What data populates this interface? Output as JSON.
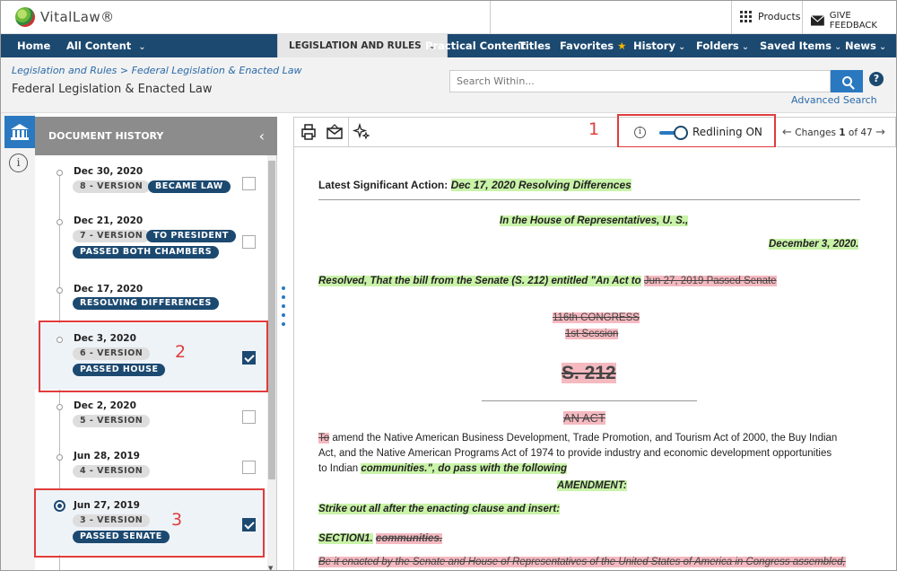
{
  "brand": {
    "name": "VitalLaw",
    "reg": "®"
  },
  "topbar": {
    "products": "Products",
    "feedback": "GIVE FEEDBACK"
  },
  "nav": {
    "home": "Home",
    "all_content": "All Content",
    "legislation": "LEGISLATION AND RULES",
    "practical": "Practical Content",
    "titles": "Titles",
    "favorites": "Favorites",
    "history": "History",
    "folders": "Folders",
    "saved": "Saved Items",
    "news": "News"
  },
  "header": {
    "breadcrumb": "Legislation and Rules > Federal Legislation & Enacted Law",
    "title": "Federal Legislation & Enacted Law",
    "search_placeholder": "Search Within...",
    "advanced": "Advanced Search"
  },
  "history_panel": {
    "title": "DOCUMENT HISTORY",
    "entries": [
      {
        "date": "Dec 30, 2020",
        "version": "8 - VERSION",
        "status": [
          "BECAME LAW"
        ],
        "checked": false
      },
      {
        "date": "Dec 21, 2020",
        "version": "7 - VERSION",
        "status": [
          "TO PRESIDENT",
          "PASSED BOTH CHAMBERS"
        ],
        "checked": false
      },
      {
        "date": "Dec 17, 2020",
        "version": "",
        "status": [
          "RESOLVING DIFFERENCES"
        ],
        "checked": false
      },
      {
        "date": "Dec 3, 2020",
        "version": "6 - VERSION",
        "status": [
          "PASSED HOUSE"
        ],
        "checked": true
      },
      {
        "date": "Dec 2, 2020",
        "version": "5 - VERSION",
        "status": [],
        "checked": false
      },
      {
        "date": "Jun 28, 2019",
        "version": "4 - VERSION",
        "status": [],
        "checked": false
      },
      {
        "date": "Jun 27, 2019",
        "version": "3 - VERSION",
        "status": [
          "PASSED SENATE"
        ],
        "checked": true
      }
    ]
  },
  "callouts": {
    "one": "1",
    "two": "2",
    "three": "3"
  },
  "toolbar": {
    "redlining": "Redlining ON",
    "changes_prefix": "Changes",
    "changes_current": "1",
    "changes_of": "of 47"
  },
  "document": {
    "lsa_label": "Latest Significant Action:",
    "lsa_value": "Dec 17, 2020 Resolving Differences",
    "house_line": "In the House of Representatives, U. S.,",
    "date_line": "December 3, 2020.",
    "resolved_text": "Resolved, That the bill from the Senate (S. 212) entitled \"An Act to",
    "resolved_deleted": "Jun 27, 2019 Passed Senate",
    "congress": "116th CONGRESS",
    "session": "1st Session",
    "bill": "S. 212",
    "an_act": "AN ACT",
    "to_deleted": "To",
    "body1": " amend the Native American Business Development, Trade Promotion, and Tourism Act of 2000, the Buy Indian",
    "body2": "Act, and the Native American Programs Act of 1974 to provide industry and economic development opportunities",
    "body3": "to Indian ",
    "body3_hl": "communities.\", do pass with the following",
    "amendment": "AMENDMENT:",
    "strike": "Strike out all after the enacting clause and insert:",
    "section": "SECTION1.",
    "section_deleted": "communities.",
    "enacted_deleted": "Be it enacted by the Senate and House of Representatives of the United States of America in Congress assembled,"
  }
}
